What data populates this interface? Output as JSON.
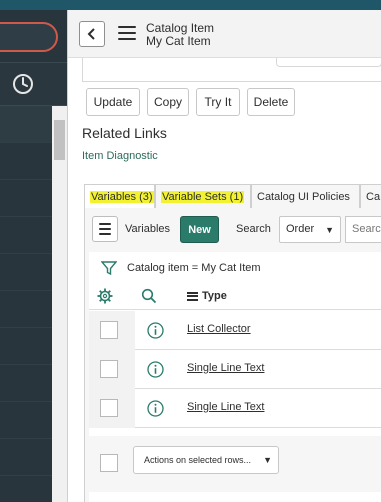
{
  "header": {
    "title": "Catalog Item",
    "subtitle": "My Cat Item"
  },
  "form_buttons": [
    "Update",
    "Copy",
    "Try It",
    "Delete"
  ],
  "related_links": {
    "title": "Related Links",
    "links": [
      "Item Diagnostic"
    ]
  },
  "tabs": [
    {
      "label": "Variables (3)",
      "highlighted": true,
      "active": true
    },
    {
      "label": "Variable Sets (1)",
      "highlighted": true,
      "active": false
    },
    {
      "label": "Catalog UI Policies",
      "highlighted": false,
      "active": false
    },
    {
      "label": "Ca",
      "highlighted": false,
      "active": false
    }
  ],
  "list_toolbar": {
    "list_name": "Variables",
    "new_label": "New",
    "search_label": "Search",
    "search_field": "Order",
    "search_placeholder": "Search"
  },
  "filter": {
    "text": "Catalog item = My Cat Item"
  },
  "columns": {
    "type": "Type"
  },
  "rows": [
    {
      "type": "List Collector"
    },
    {
      "type": "Single Line Text"
    },
    {
      "type": "Single Line Text"
    }
  ],
  "actions": {
    "placeholder": "Actions on selected rows..."
  },
  "colors": {
    "accent": "#2a7b6a",
    "highlight": "#f2f233",
    "nav": "#29353d"
  }
}
